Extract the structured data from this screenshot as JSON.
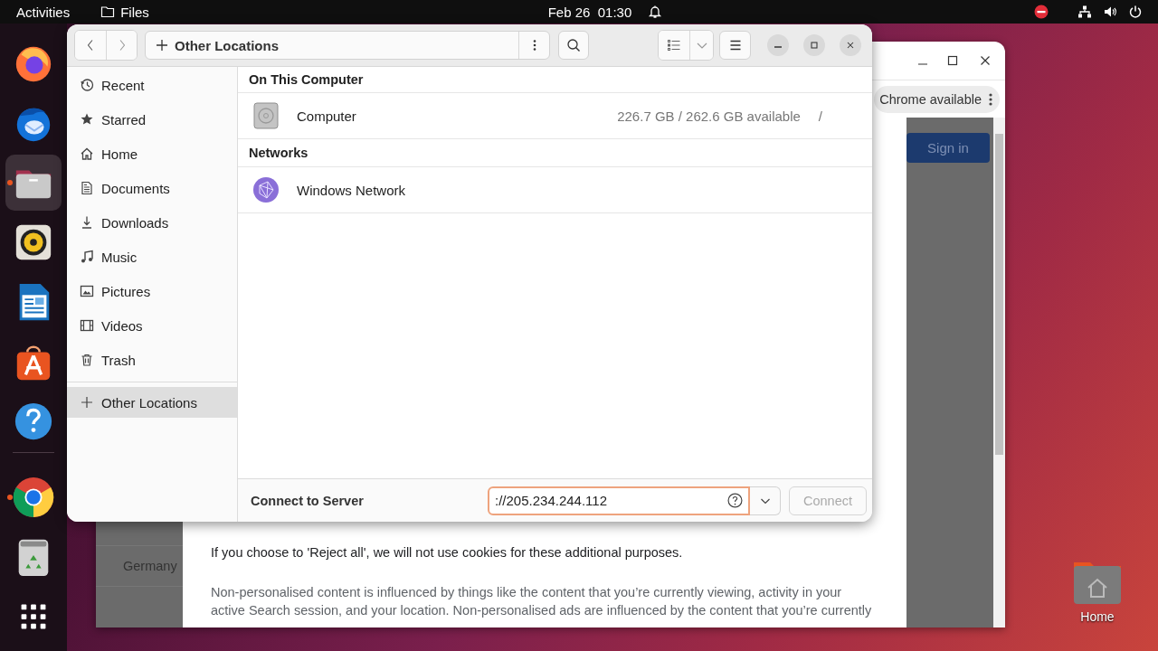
{
  "top_bar": {
    "activities": "Activities",
    "app_name": "Files",
    "clock": "Feb 26  01:30"
  },
  "dock": [
    {
      "kind": "firefox",
      "running": false,
      "selected": false
    },
    {
      "kind": "thunderbird",
      "running": false,
      "selected": false
    },
    {
      "kind": "files",
      "running": true,
      "selected": true
    },
    {
      "kind": "rhythmbox",
      "running": false,
      "selected": false
    },
    {
      "kind": "writer",
      "running": false,
      "selected": false
    },
    {
      "kind": "software",
      "running": false,
      "selected": false
    },
    {
      "kind": "help",
      "running": false,
      "selected": false
    },
    {
      "kind": "chrome",
      "running": true,
      "selected": false
    },
    {
      "kind": "trash",
      "running": false,
      "selected": false
    },
    {
      "kind": "apps",
      "running": false,
      "selected": false
    }
  ],
  "browser_window": {
    "menu_text": "Chrome available",
    "sign_in": "Sign in",
    "side_text": "Germany",
    "paragraphs": [
      "If you choose to 'Reject all', we will not use cookies for these additional purposes.",
      "Non-personalised content is influenced by things like the content that you’re currently viewing, activity in your active Search session, and your location. Non-personalised ads are influenced by the content that you’re currently"
    ]
  },
  "files_window": {
    "location": "Other Locations",
    "sidebar": {
      "places": [
        {
          "label": "Recent",
          "kind": "recent",
          "selected": false
        },
        {
          "label": "Starred",
          "kind": "starred",
          "selected": false
        },
        {
          "label": "Home",
          "kind": "home",
          "selected": false
        },
        {
          "label": "Documents",
          "kind": "documents",
          "selected": false
        },
        {
          "label": "Downloads",
          "kind": "downloads",
          "selected": false
        },
        {
          "label": "Music",
          "kind": "music",
          "selected": false
        },
        {
          "label": "Pictures",
          "kind": "pictures",
          "selected": false
        },
        {
          "label": "Videos",
          "kind": "videos",
          "selected": false
        },
        {
          "label": "Trash",
          "kind": "trash",
          "selected": false
        }
      ],
      "other": {
        "label": "Other Locations",
        "selected": true
      }
    },
    "sections": [
      {
        "title": "On This Computer",
        "items": [
          {
            "name": "Computer",
            "kind": "drive",
            "usage": "226.7 GB / 262.6 GB available",
            "path": "/"
          }
        ]
      },
      {
        "title": "Networks",
        "items": [
          {
            "name": "Windows Network",
            "kind": "network"
          }
        ]
      }
    ],
    "connect": {
      "label": "Connect to Server",
      "value": "://205.234.244.112",
      "button": "Connect",
      "button_disabled": true
    }
  },
  "desktop": {
    "home_label": "Home"
  }
}
